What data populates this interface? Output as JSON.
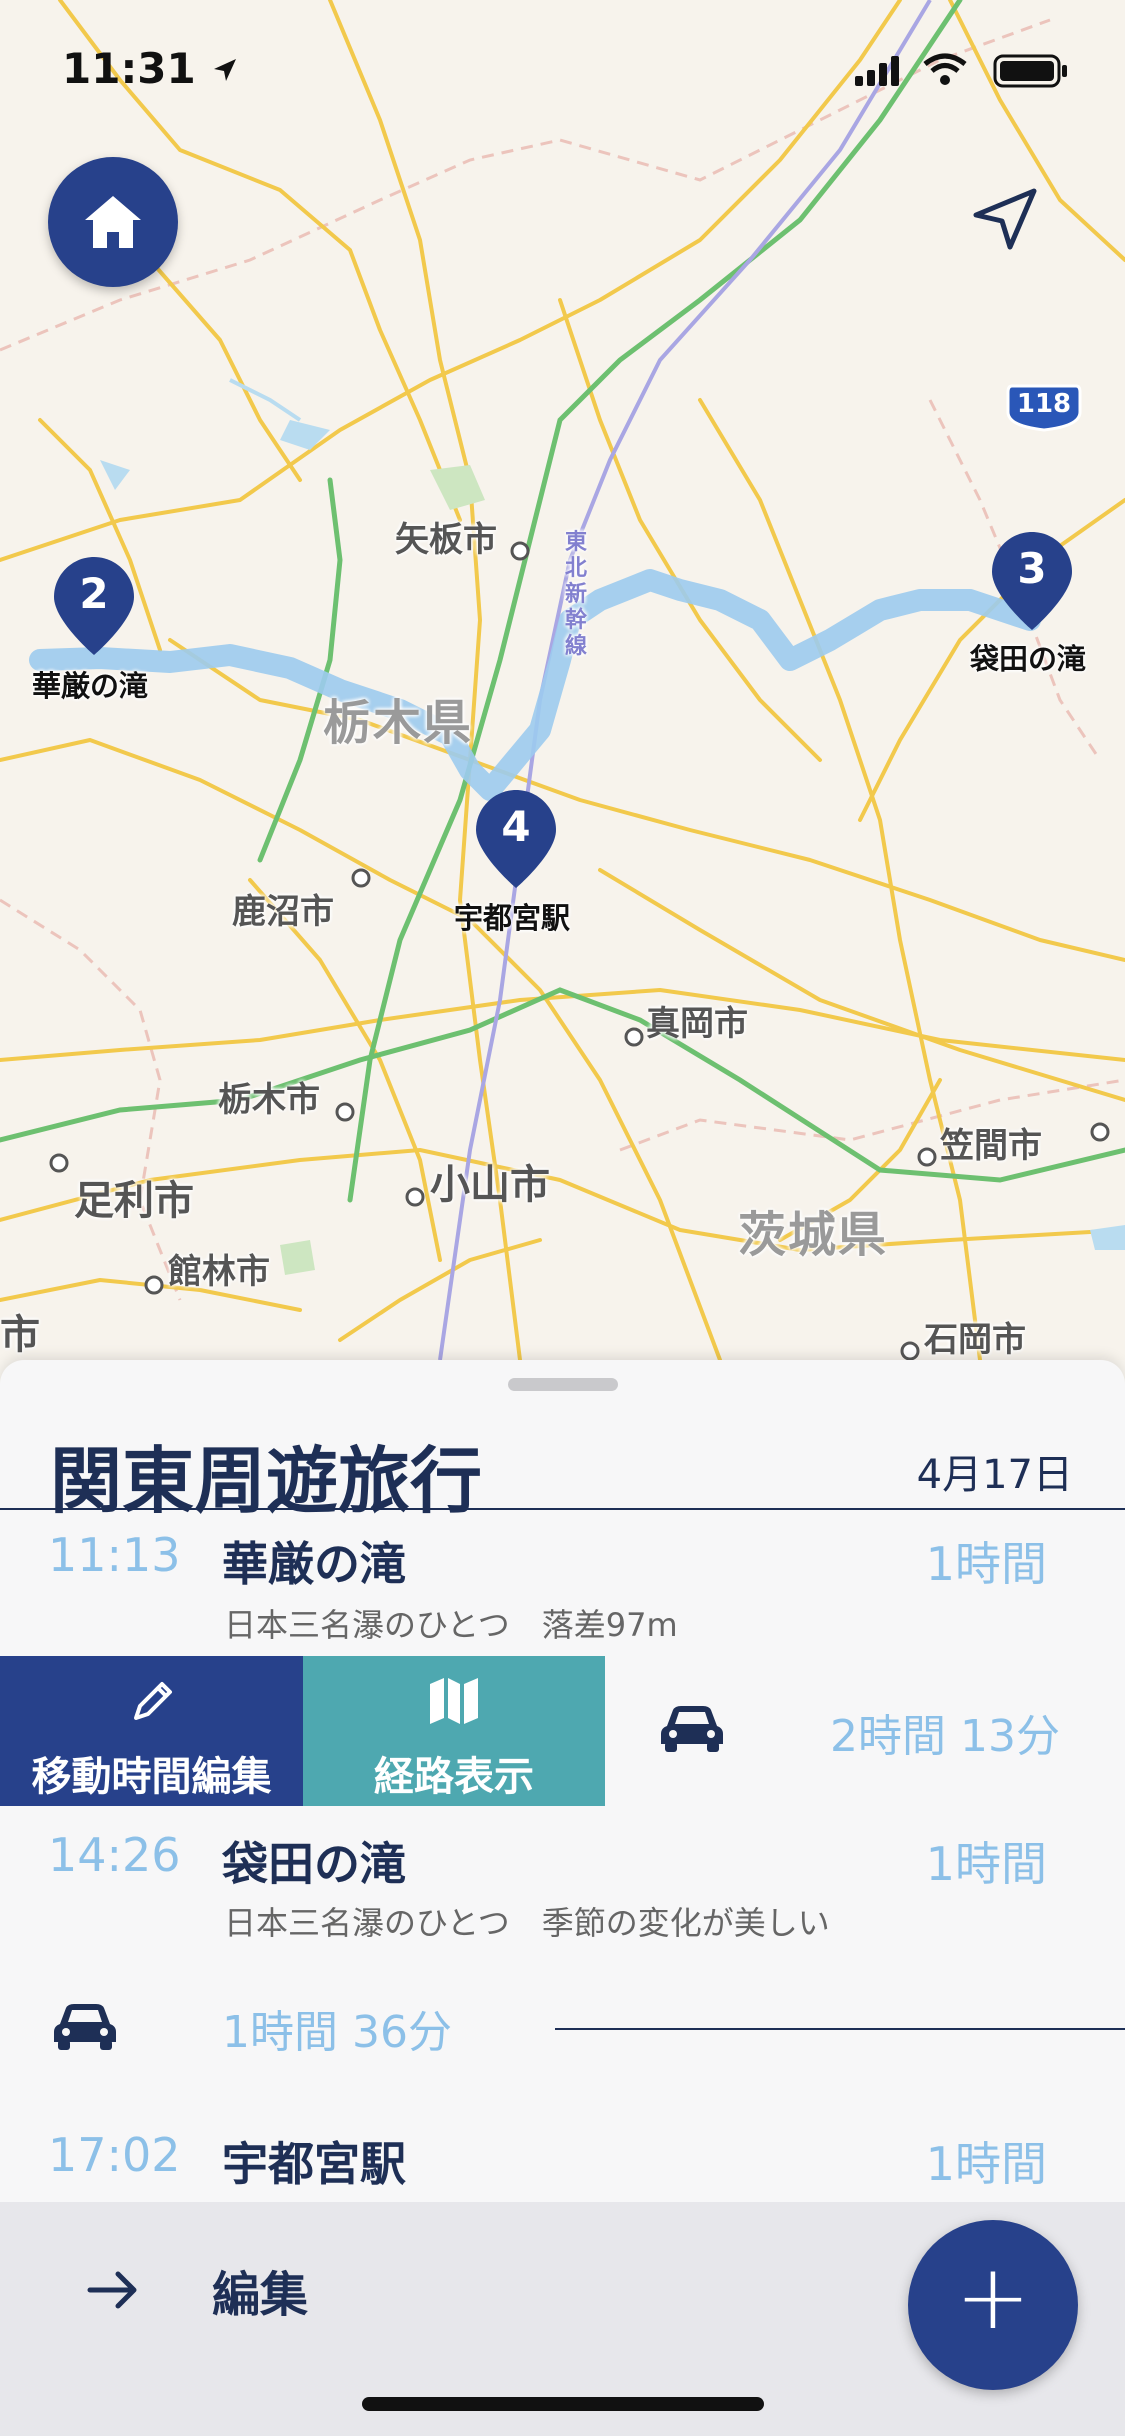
{
  "status_bar": {
    "time": "11:31"
  },
  "map": {
    "route_badge": "118",
    "cities": [
      {
        "name": "矢板市"
      },
      {
        "name": "鹿沼市"
      },
      {
        "name": "真岡市"
      },
      {
        "name": "栃木市"
      },
      {
        "name": "足利市"
      },
      {
        "name": "小山市"
      },
      {
        "name": "館林市"
      },
      {
        "name": "笠間市"
      },
      {
        "name": "石岡市"
      },
      {
        "name": "市"
      }
    ],
    "prefectures": [
      "栃木県",
      "茨城県"
    ],
    "rail_label": "東北新幹線",
    "pins": [
      {
        "number": "2",
        "label": "華厳の滝"
      },
      {
        "number": "3",
        "label": "袋田の滝"
      },
      {
        "number": "4",
        "label": "宇都宮駅"
      }
    ],
    "colors": {
      "pin": "#27418b",
      "route": "#9ccbee",
      "road": "#f2c94c",
      "rail": "#6dc070"
    }
  },
  "sheet": {
    "title": "関東周遊旅行",
    "date": "4月17日",
    "stops": [
      {
        "time": "11:13",
        "place": "華厳の滝",
        "duration": "1時間",
        "description": "日本三名瀑のひとつ　落差97m"
      },
      {
        "time": "14:26",
        "place": "袋田の滝",
        "duration": "1時間",
        "description": "日本三名瀑のひとつ　季節の変化が美しい"
      },
      {
        "time": "17:02",
        "place": "宇都宮駅",
        "duration": "1時間"
      }
    ],
    "swipe_actions": {
      "edit_travel": "移動時間編集",
      "show_route": "経路表示"
    },
    "travel_times": [
      "2時間 13分",
      "1時間 36分"
    ]
  },
  "bottom_bar": {
    "edit_label": "編集",
    "add_label": "+"
  },
  "icons": {
    "home": "home-icon",
    "locate": "location-arrow-icon",
    "car": "car-icon",
    "pencil": "pencil-icon",
    "map": "map-icon",
    "arrow": "arrow-right-icon"
  }
}
